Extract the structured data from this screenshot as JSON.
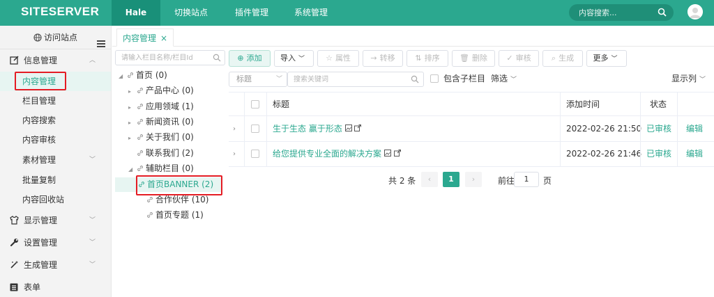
{
  "app": {
    "logo": "SITESERVER",
    "nav": [
      {
        "label": "Hale",
        "active": true
      },
      {
        "label": "切换站点"
      },
      {
        "label": "插件管理"
      },
      {
        "label": "系统管理"
      }
    ],
    "search_placeholder": "内容搜索..."
  },
  "sidebar": {
    "visit_label": "访问站点",
    "groups": {
      "info": "信息管理",
      "display": "显示管理",
      "settings": "设置管理",
      "generate": "生成管理",
      "forms": "表单"
    },
    "items": {
      "content_manage": "内容管理",
      "channel_manage": "栏目管理",
      "content_search": "内容搜索",
      "content_review": "内容审核",
      "material_manage": "素材管理",
      "batch_copy": "批量复制",
      "recycle": "内容回收站"
    }
  },
  "tab": {
    "label": "内容管理",
    "close": "×"
  },
  "tree": {
    "search_placeholder": "请输入栏目名称/栏目Id",
    "nodes": {
      "home": "首页 (0)",
      "products": "产品中心 (0)",
      "applications": "应用领域 (1)",
      "news": "新闻资讯 (0)",
      "about": "关于我们 (0)",
      "contact": "联系我们 (2)",
      "aux": "辅助栏目 (0)",
      "banner": "首页BANNER (2)",
      "partners": "合作伙伴 (10)",
      "topics": "首页专题 (1)"
    }
  },
  "toolbar": {
    "add": "添加",
    "import": "导入",
    "attributes": "属性",
    "transfer": "转移",
    "sort": "排序",
    "delete": "删除",
    "review": "审核",
    "generate": "生成",
    "more": "更多"
  },
  "filter": {
    "field_select": "标题",
    "keyword_placeholder": "搜索关键词",
    "include_children": "包含子栏目",
    "filter_label": "筛选",
    "show_columns": "显示列"
  },
  "table": {
    "headers": {
      "title": "标题",
      "added": "添加时间",
      "status": "状态"
    },
    "rows": [
      {
        "title": "生于生态 赢于形态",
        "time": "2022-02-26 21:50",
        "status": "已审核",
        "action": "编辑"
      },
      {
        "title": "给您提供专业全面的解决方案",
        "time": "2022-02-26 21:46",
        "status": "已审核",
        "action": "编辑"
      }
    ]
  },
  "pagination": {
    "total": "共 2 条",
    "current": "1",
    "goto_label": "前往",
    "goto_value": "1",
    "page_suffix": "页"
  },
  "colors": {
    "brand": "#2ba88f",
    "highlight": "#e41c24"
  }
}
